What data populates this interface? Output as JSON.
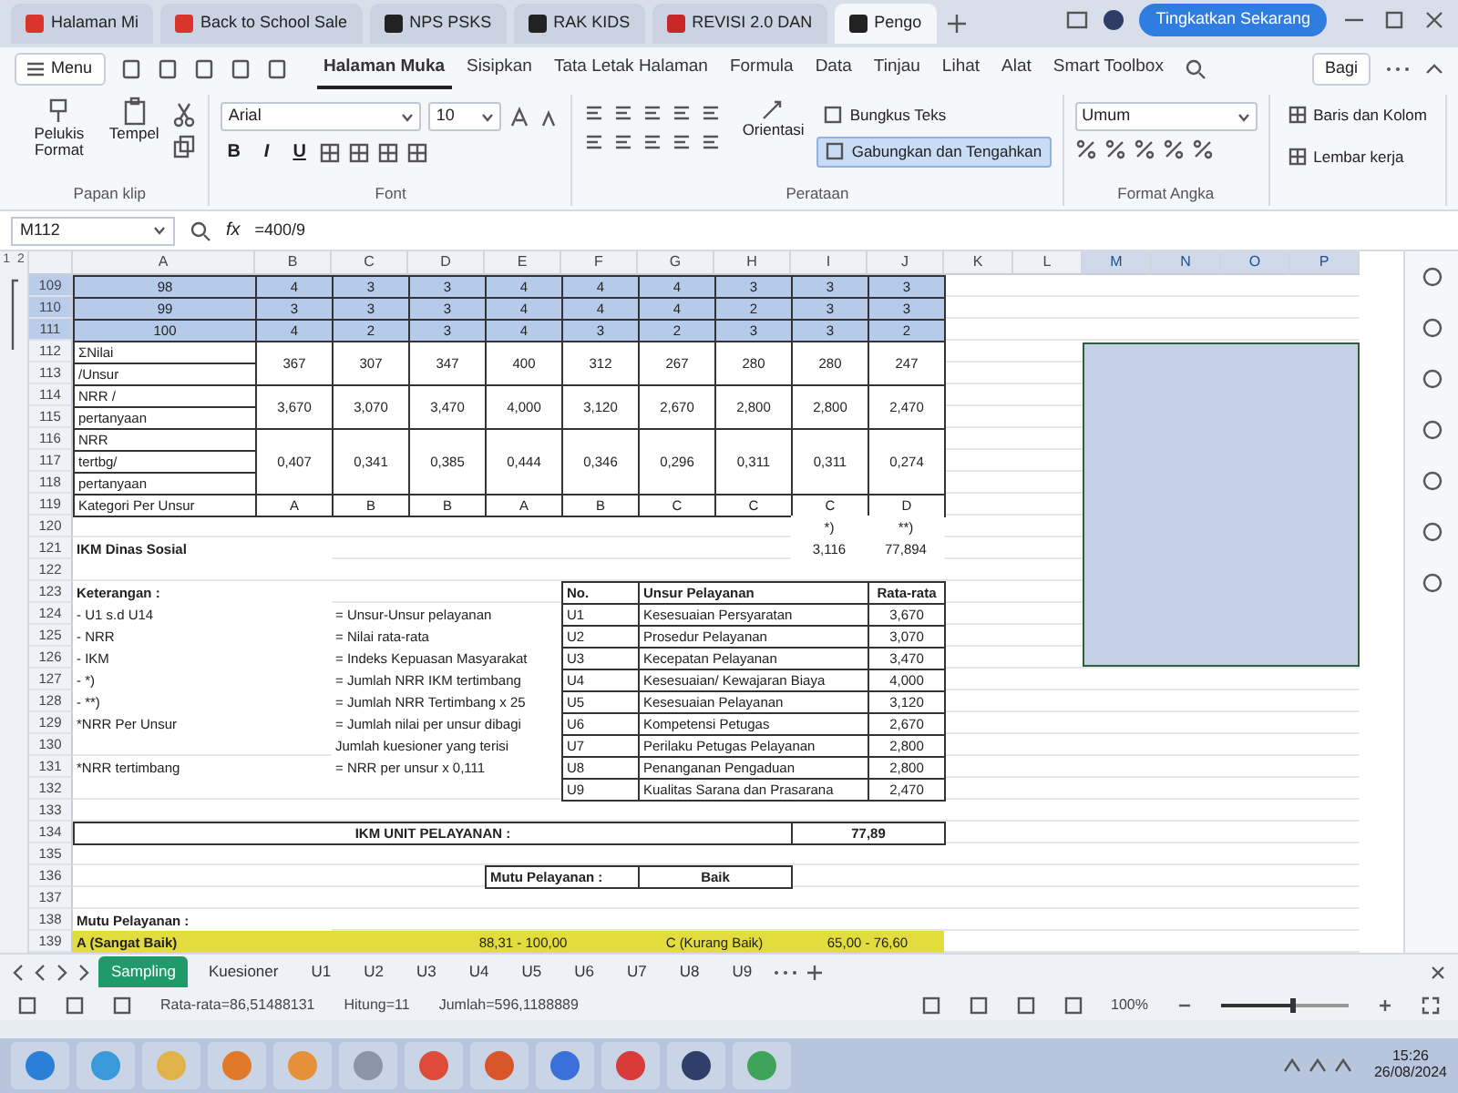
{
  "window": {
    "tabs": [
      {
        "label": "Halaman Mi",
        "selected": false,
        "color": "#d9342b"
      },
      {
        "label": "Back to School Sale",
        "selected": false,
        "color": "#d9342b"
      },
      {
        "label": "NPS PSKS",
        "selected": false,
        "color": "#222222"
      },
      {
        "label": "RAK KIDS",
        "selected": false,
        "color": "#222222"
      },
      {
        "label": "REVISI 2.0 DAN",
        "selected": false,
        "color": "#c62828"
      },
      {
        "label": "Pengo",
        "selected": true,
        "color": "#222222"
      }
    ],
    "upgrade_button": "Tingkatkan Sekarang"
  },
  "menu": {
    "label": "Menu",
    "tabs": [
      {
        "label": "Halaman Muka",
        "selected": true
      },
      {
        "label": "Sisipkan",
        "selected": false
      },
      {
        "label": "Tata Letak Halaman",
        "selected": false
      },
      {
        "label": "Formula",
        "selected": false
      },
      {
        "label": "Data",
        "selected": false
      },
      {
        "label": "Tinjau",
        "selected": false
      },
      {
        "label": "Lihat",
        "selected": false
      },
      {
        "label": "Alat",
        "selected": false
      },
      {
        "label": "Smart Toolbox",
        "selected": false
      }
    ],
    "share_button": "Bagi"
  },
  "ribbon": {
    "clipboard": {
      "title": "Papan klip",
      "format_painter": "Pelukis Format",
      "paste": "Tempel"
    },
    "font": {
      "title": "Font",
      "name": "Arial",
      "size": "10",
      "styles": [
        "B",
        "I",
        "U"
      ]
    },
    "alignment": {
      "title": "Perataan",
      "orientation": "Orientasi",
      "wrap": "Bungkus Teks",
      "merge": {
        "label": "Gabungkan dan Tengahkan",
        "on": true
      }
    },
    "number": {
      "title": "Format Angka",
      "format": "Umum"
    },
    "cells": {
      "rows_columns": "Baris dan Kolom",
      "worksheet": "Lembar kerja"
    }
  },
  "formula_bar": {
    "cell": "M112",
    "fx": "fx",
    "formula": "=400/9"
  },
  "sheet": {
    "outline_levels": [
      "1",
      "2"
    ],
    "columns": [
      {
        "label": "A",
        "selected": false
      },
      {
        "label": "B",
        "selected": false
      },
      {
        "label": "C",
        "selected": false
      },
      {
        "label": "D",
        "selected": false
      },
      {
        "label": "E",
        "selected": false
      },
      {
        "label": "F",
        "selected": false
      },
      {
        "label": "G",
        "selected": false
      },
      {
        "label": "H",
        "selected": false
      },
      {
        "label": "I",
        "selected": false
      },
      {
        "label": "J",
        "selected": false
      },
      {
        "label": "K",
        "selected": false
      },
      {
        "label": "L",
        "selected": false
      },
      {
        "label": "M",
        "selected": true
      },
      {
        "label": "N",
        "selected": true
      },
      {
        "label": "O",
        "selected": true
      },
      {
        "label": "P",
        "selected": true
      }
    ],
    "rows": [
      {
        "number": "109",
        "selected": true,
        "kind": "scores",
        "cells": [
          "98",
          "4",
          "3",
          "3",
          "4",
          "4",
          "4",
          "3",
          "3",
          "3"
        ]
      },
      {
        "number": "110",
        "selected": true,
        "kind": "scores",
        "cells": [
          "99",
          "3",
          "3",
          "3",
          "4",
          "4",
          "4",
          "2",
          "3",
          "3"
        ]
      },
      {
        "number": "111",
        "selected": true,
        "kind": "scores",
        "cells": [
          "100",
          "4",
          "2",
          "3",
          "4",
          "3",
          "2",
          "3",
          "3",
          "2"
        ]
      },
      {
        "number": "112",
        "selected": false,
        "kind": "label_values",
        "cells": [
          "ΣNilai",
          "367",
          "307",
          "347",
          "400",
          "312",
          "267",
          "280",
          "280",
          "247"
        ]
      },
      {
        "number": "113",
        "selected": false,
        "kind": "label",
        "cells": [
          "/Unsur"
        ]
      },
      {
        "number": "114",
        "selected": false,
        "kind": "label_values",
        "cells": [
          "NRR /",
          "3,670",
          "3,070",
          "3,470",
          "4,000",
          "3,120",
          "2,670",
          "2,800",
          "2,800",
          "2,470"
        ]
      },
      {
        "number": "115",
        "selected": false,
        "kind": "label",
        "cells": [
          "pertanyaan"
        ]
      },
      {
        "number": "116",
        "selected": false,
        "kind": "label_values",
        "cells": [
          "NRR",
          "0,407",
          "0,341",
          "0,385",
          "0,444",
          "0,346",
          "0,296",
          "0,311",
          "0,311",
          "0,274"
        ]
      },
      {
        "number": "117",
        "selected": false,
        "kind": "label",
        "cells": [
          "tertbg/"
        ]
      },
      {
        "number": "118",
        "selected": false,
        "kind": "label",
        "cells": [
          "pertanyaan"
        ]
      },
      {
        "number": "119",
        "selected": false,
        "kind": "label_values",
        "cells": [
          "Kategori Per Unsur",
          "A",
          "B",
          "B",
          "A",
          "B",
          "C",
          "C",
          "C",
          "D"
        ]
      },
      {
        "number": "120",
        "selected": false,
        "kind": "marks",
        "cells": [
          "*)",
          "**)"
        ]
      },
      {
        "number": "121",
        "selected": false,
        "kind": "title_values",
        "cells": [
          "IKM Dinas Sosial",
          "3,116",
          "77,894"
        ]
      },
      {
        "number": "122",
        "selected": false,
        "kind": "blank"
      },
      {
        "number": "123",
        "selected": false,
        "kind": "legend_head",
        "cells": [
          "Keterangan :",
          "No.",
          "Unsur Pelayanan",
          "Rata-rata"
        ]
      },
      {
        "number": "124",
        "selected": false,
        "kind": "legend",
        "note": "- U1 s.d U14",
        "meaning": "= Unsur-Unsur pelayanan",
        "code": "U1",
        "element": "Kesesuaian Persyaratan",
        "average": "3,670"
      },
      {
        "number": "125",
        "selected": false,
        "kind": "legend",
        "note": "- NRR",
        "meaning": "= Nilai rata-rata",
        "code": "U2",
        "element": "Prosedur Pelayanan",
        "average": "3,070"
      },
      {
        "number": "126",
        "selected": false,
        "kind": "legend",
        "note": "- IKM",
        "meaning": "= Indeks Kepuasan Masyarakat",
        "code": "U3",
        "element": "Kecepatan Pelayanan",
        "average": "3,470"
      },
      {
        "number": "127",
        "selected": false,
        "kind": "legend",
        "note": "- *)",
        "meaning": "= Jumlah NRR IKM tertimbang",
        "code": "U4",
        "element": "Kesesuaian/ Kewajaran Biaya",
        "average": "4,000"
      },
      {
        "number": "128",
        "selected": false,
        "kind": "legend",
        "note": "- **)",
        "meaning": "= Jumlah NRR Tertimbang x 25",
        "code": "U5",
        "element": "Kesesuaian Pelayanan",
        "average": "3,120"
      },
      {
        "number": "129",
        "selected": false,
        "kind": "legend",
        "note": "*NRR Per Unsur",
        "meaning": "= Jumlah nilai per unsur dibagi",
        "code": "U6",
        "element": "Kompetensi Petugas",
        "average": "2,670"
      },
      {
        "number": "130",
        "selected": false,
        "kind": "legend",
        "meaning": "Jumlah kuesioner yang terisi",
        "code": "U7",
        "element": "Perilaku Petugas Pelayanan",
        "average": "2,800"
      },
      {
        "number": "131",
        "selected": false,
        "kind": "legend",
        "note": "*NRR tertimbang",
        "meaning": "= NRR per unsur x 0,111",
        "code": "U8",
        "element": "Penanganan Pengaduan",
        "average": "2,800"
      },
      {
        "number": "132",
        "selected": false,
        "kind": "legend",
        "code": "U9",
        "element": "Kualitas Sarana dan Prasarana",
        "average": "2,470"
      },
      {
        "number": "133",
        "selected": false,
        "kind": "blank"
      },
      {
        "number": "134",
        "selected": false,
        "kind": "total",
        "cells": [
          "IKM UNIT PELAYANAN :",
          "77,89"
        ]
      },
      {
        "number": "135",
        "selected": false,
        "kind": "blank"
      },
      {
        "number": "136",
        "selected": false,
        "kind": "quality",
        "cells": [
          "Mutu Pelayanan :",
          "Baik"
        ]
      },
      {
        "number": "137",
        "selected": false,
        "kind": "blank"
      },
      {
        "number": "138",
        "selected": false,
        "kind": "heading",
        "cells": [
          "Mutu Pelayanan :"
        ]
      },
      {
        "number": "139",
        "selected": false,
        "kind": "ranges",
        "cells": [
          "A (Sangat Baik)",
          "88,31 - 100,00",
          "C (Kurang Baik)",
          "65,00 - 76,60"
        ]
      }
    ]
  },
  "sheet_tabs": [
    {
      "label": "Sampling",
      "selected": true
    },
    {
      "label": "Kuesioner",
      "selected": false
    },
    {
      "label": "U1",
      "selected": false
    },
    {
      "label": "U2",
      "selected": false
    },
    {
      "label": "U3",
      "selected": false
    },
    {
      "label": "U4",
      "selected": false
    },
    {
      "label": "U5",
      "selected": false
    },
    {
      "label": "U6",
      "selected": false
    },
    {
      "label": "U7",
      "selected": false
    },
    {
      "label": "U8",
      "selected": false
    },
    {
      "label": "U9",
      "selected": false
    }
  ],
  "status_bar": {
    "average": "Rata-rata=86,51488131",
    "count": "Hitung=11",
    "sum": "Jumlah=596,1188889",
    "zoom": "100%",
    "zoom_slider": {
      "level": 0.55
    }
  },
  "taskbar": {
    "clock": "15:26",
    "date": "26/08/2024"
  }
}
